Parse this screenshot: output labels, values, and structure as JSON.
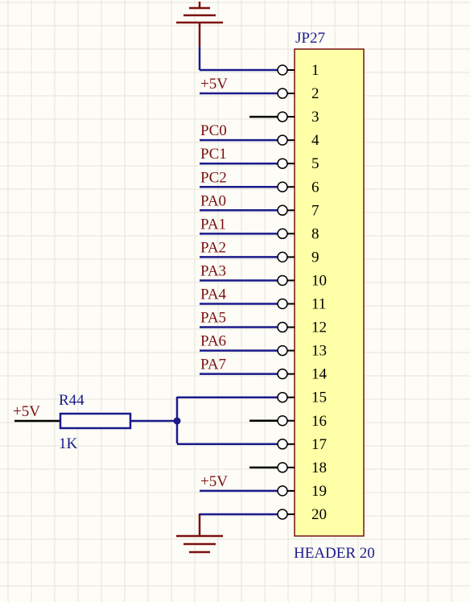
{
  "schematic": {
    "connector": {
      "designator": "JP27",
      "part_name": "HEADER 20",
      "body_color": "#ffffa8",
      "pins": [
        {
          "number": "1",
          "net": ""
        },
        {
          "number": "2",
          "net": "+5V"
        },
        {
          "number": "3",
          "net": ""
        },
        {
          "number": "4",
          "net": "PC0"
        },
        {
          "number": "5",
          "net": "PC1"
        },
        {
          "number": "6",
          "net": "PC2"
        },
        {
          "number": "7",
          "net": "PA0"
        },
        {
          "number": "8",
          "net": "PA1"
        },
        {
          "number": "9",
          "net": "PA2"
        },
        {
          "number": "10",
          "net": "PA3"
        },
        {
          "number": "11",
          "net": "PA4"
        },
        {
          "number": "12",
          "net": "PA5"
        },
        {
          "number": "13",
          "net": "PA6"
        },
        {
          "number": "14",
          "net": "PA7"
        },
        {
          "number": "15",
          "net": ""
        },
        {
          "number": "16",
          "net": ""
        },
        {
          "number": "17",
          "net": ""
        },
        {
          "number": "18",
          "net": ""
        },
        {
          "number": "19",
          "net": "+5V"
        },
        {
          "number": "20",
          "net": ""
        }
      ]
    },
    "resistor": {
      "designator": "R44",
      "value": "1K",
      "supply_label": "+5V"
    },
    "colors": {
      "wire": "#1a1a8c",
      "power": "#7a1010",
      "grid": "#e4e4dc",
      "connector_outline": "#7a1010"
    }
  }
}
